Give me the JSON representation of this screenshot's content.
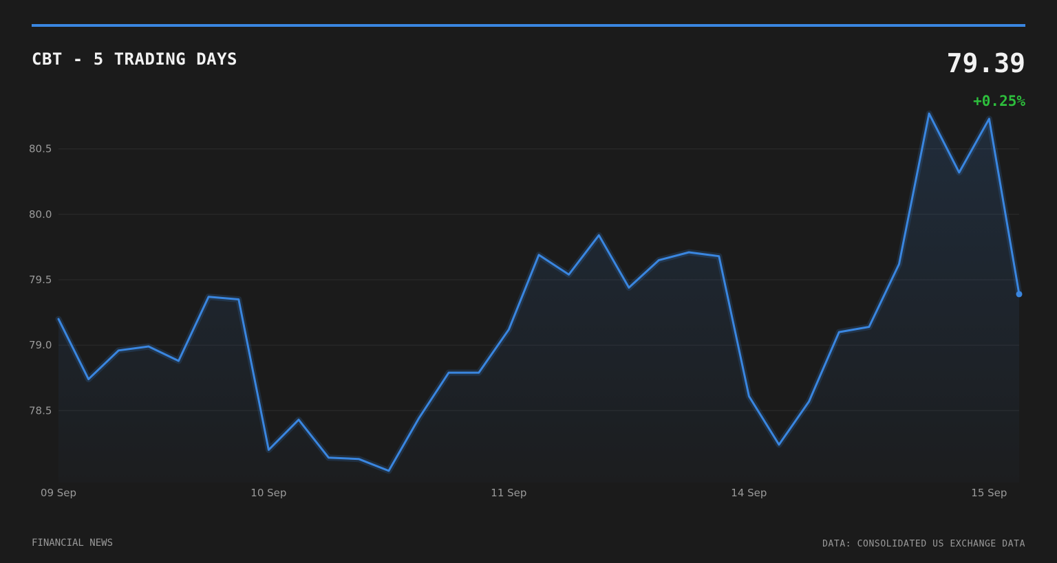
{
  "header": {
    "title": "CBT - 5 TRADING DAYS",
    "price": "79.39",
    "change": "+0.25%"
  },
  "footer": {
    "source_left": "FINANCIAL NEWS",
    "source_right": "DATA: CONSOLIDATED US EXCHANGE DATA"
  },
  "colors": {
    "background": "#1b1b1b",
    "accent": "#3a86e0",
    "positive": "#2dbe3c",
    "text": "#f2f2f2",
    "muted": "#9a9a9a",
    "grid": "#2c2c2c"
  },
  "chart_data": {
    "type": "area",
    "title": "CBT - 5 TRADING DAYS",
    "xlabel": "",
    "ylabel": "",
    "ylim": [
      77.95,
      80.85
    ],
    "yticks": [
      78.5,
      79.0,
      79.5,
      80.0,
      80.5
    ],
    "ytick_labels": [
      "78.5",
      "79.0",
      "79.5",
      "80.0",
      "80.5"
    ],
    "xtick_labels": [
      {
        "label": "09 Sep",
        "index": 0
      },
      {
        "label": "10 Sep",
        "index": 7
      },
      {
        "label": "11 Sep",
        "index": 15
      },
      {
        "label": "14 Sep",
        "index": 23
      },
      {
        "label": "15 Sep",
        "index": 31
      }
    ],
    "grid": true,
    "legend": "none",
    "series": [
      {
        "values": [
          79.2,
          78.74,
          78.96,
          78.99,
          78.88,
          79.37,
          79.35,
          78.2,
          78.43,
          78.14,
          78.13,
          78.04,
          78.44,
          78.79,
          78.79,
          79.12,
          79.69,
          79.54,
          79.84,
          79.44,
          79.65,
          79.71,
          79.68,
          78.61,
          78.24,
          78.57,
          79.1,
          79.14,
          79.62,
          80.77,
          80.32,
          80.73,
          79.39
        ]
      }
    ]
  }
}
